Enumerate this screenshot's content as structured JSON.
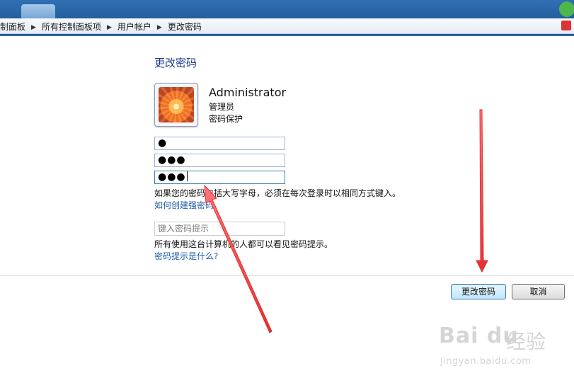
{
  "breadcrumb": [
    "制面板",
    "所有控制面板项",
    "用户帐户",
    "更改密码"
  ],
  "page_title": "更改密码",
  "user": {
    "name": "Administrator",
    "role": "管理员",
    "protection": "密码保护"
  },
  "fields": {
    "current_password": "●",
    "new_password": "●●●",
    "confirm_password": "●●●",
    "hint_placeholder": "键入密码提示"
  },
  "notes": {
    "case_sensitive": "如果您的密码包括大写字母，必须在每次登录时以相同方式键入。",
    "strong_password_link": "如何创建强密码",
    "hint_visibility": "所有使用这台计算机的人都可以看见密码提示。",
    "hint_help_link": "密码提示是什么?"
  },
  "buttons": {
    "change_password": "更改密码",
    "cancel": "取消"
  },
  "watermark": {
    "logo": "Bai du",
    "text": "经验",
    "url": "jingyan.baidu.com"
  },
  "colors": {
    "accent": "#1f5ea8",
    "title": "#1e3a8a",
    "arrow": "#ef3b3b"
  }
}
